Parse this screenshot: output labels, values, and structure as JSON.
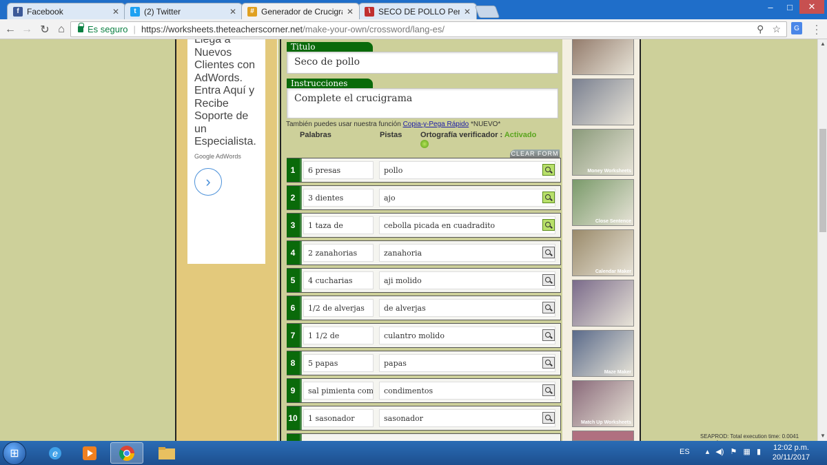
{
  "browser": {
    "tabs": [
      {
        "title": "Facebook",
        "icon": "facebook-icon",
        "color": "#3b5998"
      },
      {
        "title": "(2) Twitter",
        "icon": "twitter-icon",
        "color": "#1da1f2"
      },
      {
        "title": "Generador de Crucigrama",
        "icon": "crossword-icon",
        "color": "#e0a020"
      },
      {
        "title": "SECO DE POLLO Peruano",
        "icon": "recipe-icon",
        "color": "#c03030"
      }
    ],
    "url": {
      "secure_label": "Es seguro",
      "host": "https://worksheets.theteacherscorner.net",
      "path": "/make-your-own/crossword/lang-es/"
    }
  },
  "ad": {
    "text": "Llega a Nuevos Clientes con AdWords. Entra Aquí y Recibe Soporte de un Especialista.",
    "source": "Google AdWords"
  },
  "form": {
    "title_label": "Titulo",
    "title_value": "Seco de pollo",
    "instructions_label": "Instrucciones",
    "instructions_value": "Complete el crucigrama",
    "hint_prefix": "También puedes usar nuestra función",
    "hint_link": "Copia-y-Pega Rápido",
    "hint_suffix": "*NUEVO*",
    "col_words": "Palabras",
    "col_clues": "Pistas",
    "spell_label": "Ortografía verificador :",
    "spell_status": "Activado",
    "clear_label": "CLEAR FORM",
    "rows": [
      {
        "n": "1",
        "word": "6 presas",
        "clue": "pollo",
        "lit": true
      },
      {
        "n": "2",
        "word": "3 dientes",
        "clue": "ajo",
        "lit": true
      },
      {
        "n": "3",
        "word": "1 taza de",
        "clue": "cebolla picada en cuadradito",
        "lit": true
      },
      {
        "n": "4",
        "word": "2 zanahorias",
        "clue": "zanahoria",
        "lit": false
      },
      {
        "n": "5",
        "word": "4 cucharias",
        "clue": "aji molido",
        "lit": false
      },
      {
        "n": "6",
        "word": "1/2 de alverjas",
        "clue": "de alverjas",
        "lit": false
      },
      {
        "n": "7",
        "word": "1 1/2 de",
        "clue": "culantro molido",
        "lit": false
      },
      {
        "n": "8",
        "word": "5 papas",
        "clue": "papas",
        "lit": false
      },
      {
        "n": "9",
        "word": "sal pimienta comi",
        "clue": "condimentos",
        "lit": false
      },
      {
        "n": "10",
        "word": "1 sasonador",
        "clue": "sasonador",
        "lit": false
      }
    ]
  },
  "sidebar_thumbs": [
    {
      "caption": "",
      "color": "#8a7060"
    },
    {
      "caption": "",
      "color": "#7a8090"
    },
    {
      "caption": "Money Worksheets",
      "color": "#8a9a7a"
    },
    {
      "caption": "Close Sentence",
      "color": "#7a9a6a"
    },
    {
      "caption": "Calendar Maker",
      "color": "#9a8a6a"
    },
    {
      "caption": "",
      "color": "#7a6a8a"
    },
    {
      "caption": "Maze Maker",
      "color": "#5a6a8a"
    },
    {
      "caption": "Match Up Worksheets",
      "color": "#8a6a7a"
    }
  ],
  "exec_time": "SEAPROD: Total execution time: 0.0041 seconds.",
  "taskbar": {
    "lang": "ES",
    "time": "12:02 p.m.",
    "date": "20/11/2017"
  }
}
